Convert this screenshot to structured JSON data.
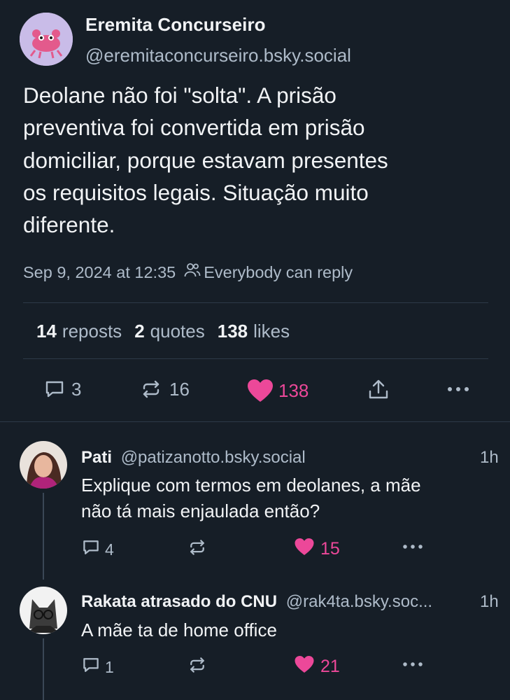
{
  "post": {
    "author_name": "Eremita Concurseiro",
    "author_handle": "@eremitaconcurseiro.bsky.social",
    "text_lines": [
      "Deolane não foi \"solta\". A prisão",
      "preventiva foi convertida em prisão",
      "domiciliar, porque estavam presentes",
      "os requisitos legais. Situação muito",
      "diferente."
    ],
    "timestamp": "Sep 9, 2024 at 12:35",
    "reply_setting": "Everybody can reply",
    "stats": {
      "reposts_count": "14",
      "reposts_label": "reposts",
      "quotes_count": "2",
      "quotes_label": "quotes",
      "likes_count": "138",
      "likes_label": "likes"
    },
    "actions": {
      "reply_count": "3",
      "repost_count": "16",
      "like_count": "138"
    }
  },
  "replies": [
    {
      "name": "Pati",
      "handle": "@patizanotto.bsky.social",
      "time": "1h",
      "text_lines": [
        "Explique com termos em deolanes, a mãe",
        "não tá mais enjaulada então?"
      ],
      "reply_count": "4",
      "like_count": "15"
    },
    {
      "name": "Rakata atrasado do CNU",
      "handle": "@rak4ta.bsky.soc...",
      "time": "1h",
      "text_lines": [
        "A mãe ta de home office"
      ],
      "reply_count": "1",
      "like_count": "21"
    }
  ],
  "colors": {
    "background": "#161e27",
    "accent_like": "#ec4899",
    "muted_text": "#aebbc9",
    "divider": "#2d3a48"
  },
  "icons": [
    "reply-icon",
    "repost-icon",
    "heart-icon",
    "share-icon",
    "more-icon",
    "people-icon"
  ]
}
